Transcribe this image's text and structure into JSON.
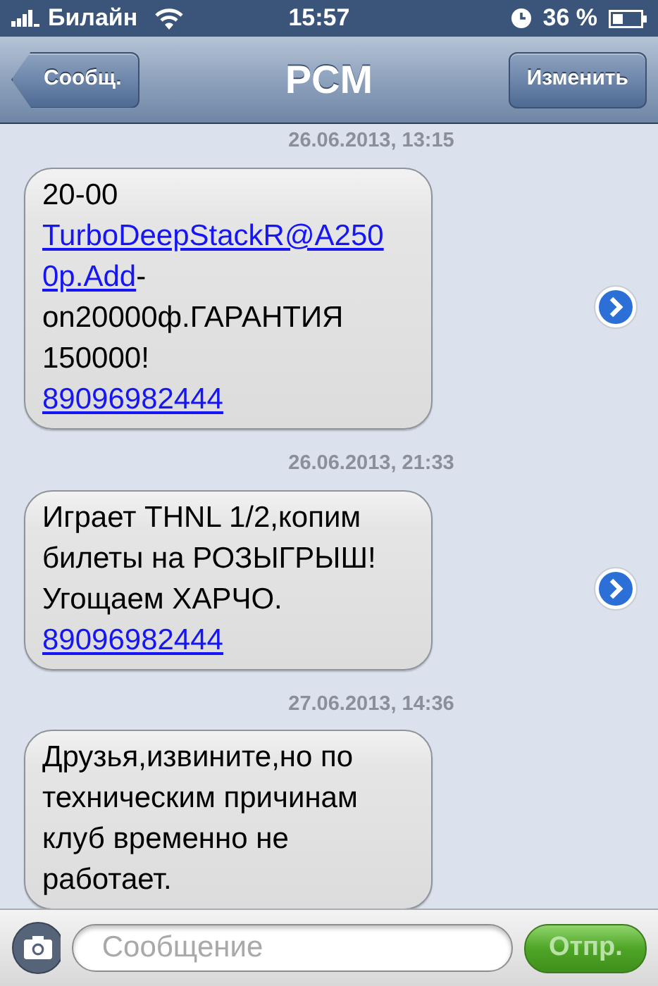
{
  "status_bar": {
    "carrier": "Билайн",
    "time": "15:57",
    "battery": "36 %"
  },
  "nav_bar": {
    "back": "Сообщ.",
    "title": "PCM",
    "edit": "Изменить"
  },
  "messages": [
    {
      "timestamp": "26.06.2013, 13:15",
      "lines": [
        [
          {
            "text": "20-00",
            "link": false
          }
        ],
        [
          {
            "text": "TurboDeepStackR@A250",
            "link": true
          }
        ],
        [
          {
            "text": "0p.Add",
            "link": true
          },
          {
            "text": "-",
            "link": false
          }
        ],
        [
          {
            "text": "on20000ф.ГАРАНТИЯ",
            "link": false
          }
        ],
        [
          {
            "text": "150000!",
            "link": false
          }
        ],
        [
          {
            "text": "89096982444",
            "link": true
          }
        ]
      ]
    },
    {
      "timestamp": "26.06.2013, 21:33",
      "lines": [
        [
          {
            "text": "Играет THNL 1/2,копим",
            "link": false
          }
        ],
        [
          {
            "text": "билеты на РОЗЫГРЫШ!",
            "link": false
          }
        ],
        [
          {
            "text": "Угощаем ХАРЧО.",
            "link": false
          }
        ],
        [
          {
            "text": "89096982444",
            "link": true
          }
        ]
      ]
    },
    {
      "timestamp": "27.06.2013, 14:36",
      "lines": [
        [
          {
            "text": "Друзья,извините,но по",
            "link": false
          }
        ],
        [
          {
            "text": "техническим причинам",
            "link": false
          }
        ],
        [
          {
            "text": "клуб временно не",
            "link": false
          }
        ],
        [
          {
            "text": "работает.",
            "link": false
          }
        ]
      ]
    }
  ],
  "compose": {
    "placeholder": "Сообщение",
    "send": "Отпр."
  }
}
